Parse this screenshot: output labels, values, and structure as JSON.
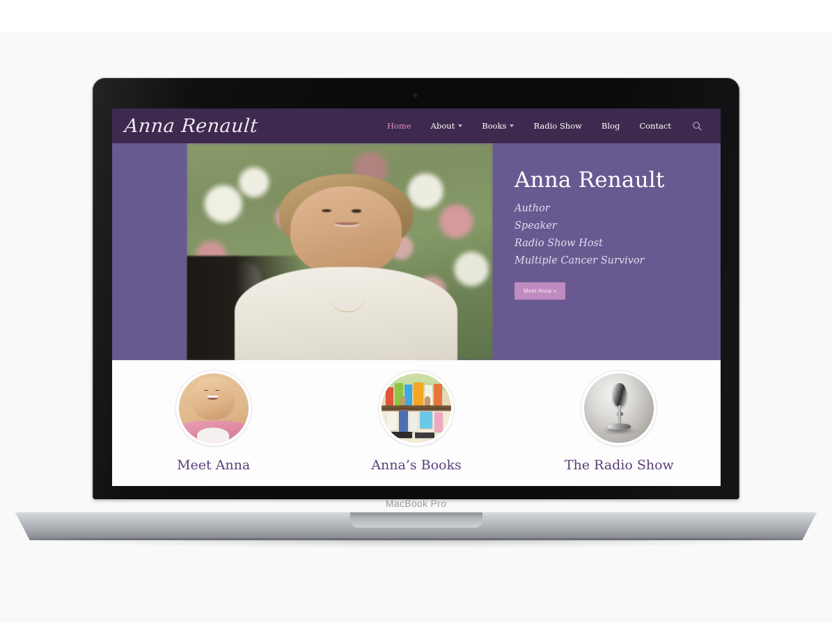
{
  "device": {
    "brand_label": "MacBook Pro"
  },
  "site": {
    "logo": "Anna Renault",
    "nav": [
      {
        "label": "Home",
        "icon": "",
        "active": true
      },
      {
        "label": "About",
        "icon": "chevron-down-icon",
        "active": false
      },
      {
        "label": "Books",
        "icon": "chevron-down-icon",
        "active": false
      },
      {
        "label": "Radio Show",
        "icon": "",
        "active": false
      },
      {
        "label": "Blog",
        "icon": "",
        "active": false
      },
      {
        "label": "Contact",
        "icon": "",
        "active": false
      }
    ],
    "search_icon": "search-icon",
    "hero": {
      "title": "Anna Renault",
      "subtitles": [
        "Author",
        "Speaker",
        "Radio Show Host",
        "Multiple Cancer Survivor"
      ],
      "cta_label": "Meet Anna »",
      "photo_alt": "portrait of Anna Renault seated outdoors in front of a flower garden"
    },
    "cards": [
      {
        "title": "Meet Anna",
        "image_alt": "smiling woman in pink top"
      },
      {
        "title": "Anna’s Books",
        "image_alt": "bookshelf display of colorful books"
      },
      {
        "title": "The Radio Show",
        "image_alt": "vintage chrome microphone"
      }
    ],
    "colors": {
      "header_purple": "#3d2a4e",
      "hero_purple": "#685a90",
      "nav_active_pink": "#e08fbe",
      "cta_pink": "#c08bc0",
      "card_title_purple": "#5b3f78"
    }
  }
}
